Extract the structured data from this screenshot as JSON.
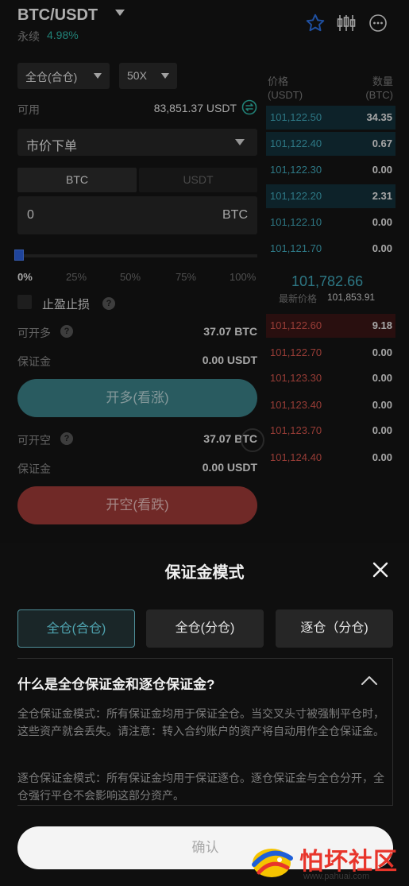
{
  "header": {
    "pair": "BTC/USDT",
    "contract_type": "永续",
    "change": "4.98%"
  },
  "icons": {
    "favorite": "star-outline-icon",
    "chart": "candlestick-icon",
    "more": "more-dots-icon",
    "swap": "swap-icon",
    "close": "close-x-icon",
    "collapse": "chevron-up-icon"
  },
  "order_form": {
    "margin_mode": "全仓(合仓)",
    "leverage": "50X",
    "available_label": "可用",
    "available_value": "83,851.37 USDT",
    "order_type": "市价下单",
    "unit_btc": "BTC",
    "unit_usdt": "USDT",
    "quantity": "0",
    "quantity_unit": "BTC",
    "slider_percent": 0,
    "slider_ticks": [
      "0%",
      "25%",
      "50%",
      "75%",
      "100%"
    ],
    "tp_sl_label": "止盈止损",
    "can_long_label": "可开多",
    "can_long_value": "37.07 BTC",
    "long_margin_label": "保证金",
    "long_margin_value": "0.00 USDT",
    "long_button": "开多(看涨)",
    "can_short_label": "可开空",
    "can_short_value": "37.07 BTC",
    "short_margin_label": "保证金",
    "short_margin_value": "0.00 USDT",
    "short_button": "开空(看跌)"
  },
  "order_book": {
    "price_header_1": "价格",
    "price_header_2": "(USDT)",
    "qty_header_1": "数量",
    "qty_header_2": "(BTC)",
    "bids": [
      {
        "price": "101,122.50",
        "qty": "34.35"
      },
      {
        "price": "101,122.40",
        "qty": "0.67"
      },
      {
        "price": "101,122.30",
        "qty": "0.00"
      },
      {
        "price": "101,122.20",
        "qty": "2.31"
      },
      {
        "price": "101,122.10",
        "qty": "0.00"
      },
      {
        "price": "101,121.70",
        "qty": "0.00"
      }
    ],
    "last_price": "101,782.66",
    "mark_label": "最新价格",
    "mark_price": "101,853.91",
    "asks": [
      {
        "price": "101,122.60",
        "qty": "9.18"
      },
      {
        "price": "101,122.70",
        "qty": "0.00"
      },
      {
        "price": "101,123.30",
        "qty": "0.00"
      },
      {
        "price": "101,123.40",
        "qty": "0.00"
      },
      {
        "price": "101,123.70",
        "qty": "0.00"
      },
      {
        "price": "101,124.40",
        "qty": "0.00"
      }
    ]
  },
  "sheet": {
    "title": "保证金模式",
    "modes": [
      "全仓(合仓)",
      "全仓(分仓)",
      "逐仓（分仓)"
    ],
    "selected_mode": "全仓(合仓)",
    "faq_title": "什么是全仓保证金和逐仓保证金?",
    "faq_p1": "全仓保证金模式：所有保证金均用于保证全仓。当交叉头寸被强制平仓时，这些资产就会丢失。请注意：转入合约账户的资产将自动用作全仓保证金。",
    "faq_p2": "逐仓保证金模式：所有保证金均用于保证逐仓。逐仓保证金与全仓分开，全仓强行平仓不会影响这部分资产。",
    "confirm": "确认"
  },
  "watermark": {
    "text": "怕坏社区",
    "url": "www.pahuai.com"
  },
  "colors": {
    "bid": "#3fa6b8",
    "ask": "#d2544b",
    "long": "#3a7f86",
    "short": "#9b3a36",
    "accent": "#2b5fd9"
  }
}
